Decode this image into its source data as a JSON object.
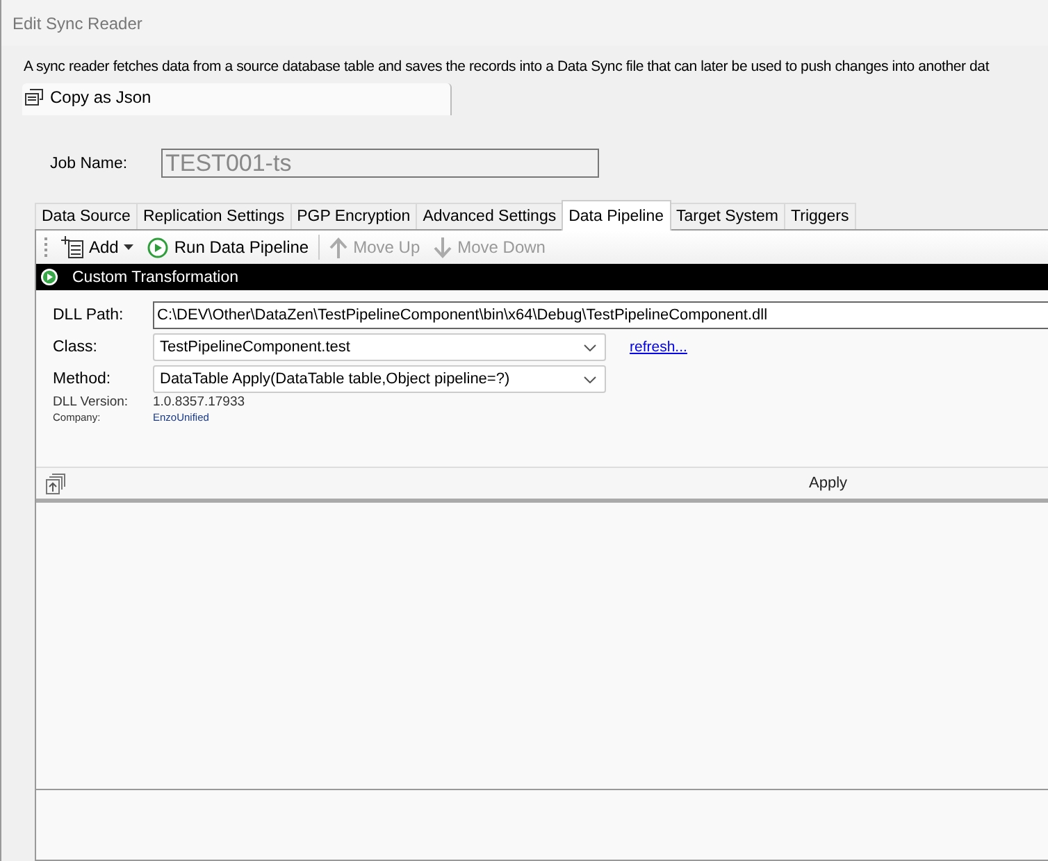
{
  "window": {
    "title": "Edit Sync Reader"
  },
  "description": "A sync reader fetches data from a source database table and saves the records into a Data Sync file that can later be used to push changes into another dat",
  "copy_button": {
    "label": "Copy as Json"
  },
  "job_name": {
    "label": "Job Name:",
    "value": "TEST001-ts",
    "disabled": true
  },
  "tabs": [
    {
      "label": "Data Source",
      "selected": false
    },
    {
      "label": "Replication Settings",
      "selected": false
    },
    {
      "label": "PGP Encryption",
      "selected": false
    },
    {
      "label": "Advanced Settings",
      "selected": false
    },
    {
      "label": "Data Pipeline",
      "selected": true
    },
    {
      "label": "Target System",
      "selected": false
    },
    {
      "label": "Triggers",
      "selected": false
    }
  ],
  "toolbar": [
    {
      "kind": "add",
      "label": "Add",
      "disabled": false
    },
    {
      "kind": "run",
      "label": "Run Data Pipeline",
      "disabled": false
    },
    {
      "kind": "up",
      "label": "Move Up",
      "disabled": true
    },
    {
      "kind": "down",
      "label": "Move Down",
      "disabled": true
    }
  ],
  "step_header": {
    "title": "Custom Transformation"
  },
  "form": {
    "dll_path": {
      "label": "DLL Path:",
      "value": "C:\\DEV\\Other\\DataZen\\TestPipelineComponent\\bin\\x64\\Debug\\TestPipelineComponent.dll"
    },
    "class": {
      "label": "Class:",
      "value": "TestPipelineComponent.test"
    },
    "refresh_link": "refresh...",
    "method": {
      "label": "Method:",
      "value": "DataTable Apply(DataTable table,Object pipeline=?)"
    },
    "dll_version": {
      "label": "DLL Version:",
      "value": "1.0.8357.17933"
    },
    "company": {
      "label": "Company:",
      "value": "EnzoUnified"
    }
  },
  "apply_button": {
    "label": "Apply"
  }
}
